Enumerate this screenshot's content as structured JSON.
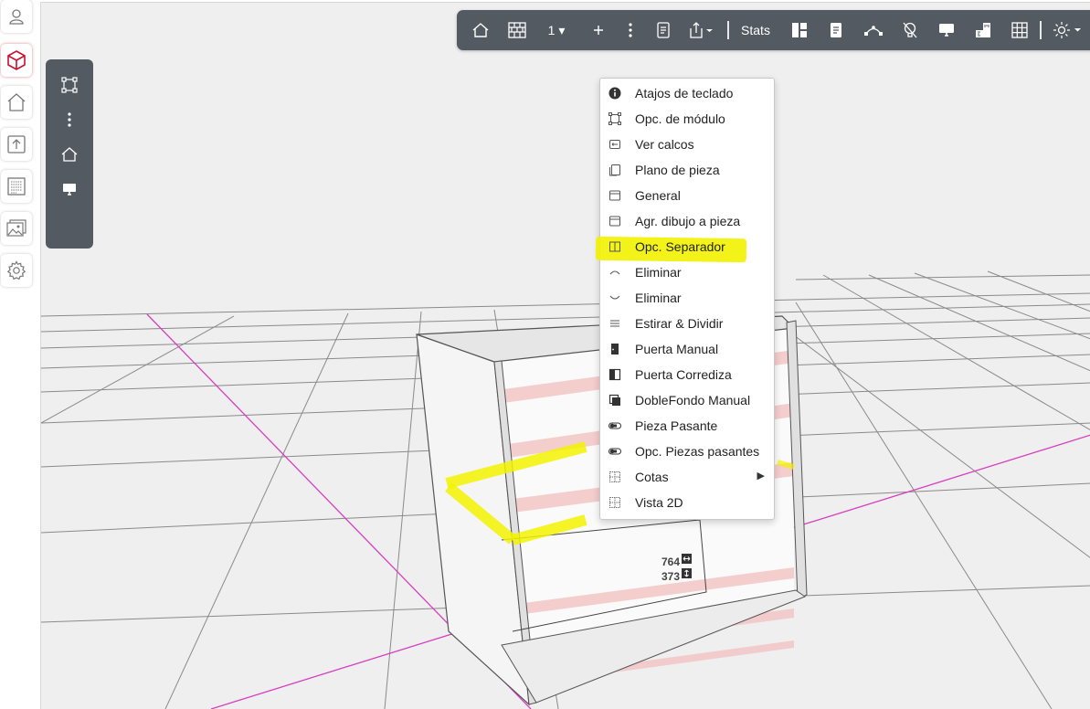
{
  "toolbar": {
    "level_label": "1 ▾",
    "stats_label": "Stats"
  },
  "context_menu": {
    "items": [
      {
        "label": "Atajos de teclado",
        "icon": "info-icon"
      },
      {
        "label": "Opc. de módulo",
        "icon": "module-frame-icon"
      },
      {
        "label": "Ver calcos",
        "icon": "decal-icon"
      },
      {
        "label": "Plano de pieza",
        "icon": "copy-sheet-icon"
      },
      {
        "label": "General",
        "icon": "window-icon"
      },
      {
        "label": "Agr. dibujo a pieza",
        "icon": "window-icon"
      },
      {
        "label": "Opc. Separador",
        "icon": "split-panel-icon"
      },
      {
        "label": "Eliminar",
        "icon": "chevron-up-icon"
      },
      {
        "label": "Eliminar",
        "icon": "chevron-down-icon"
      },
      {
        "label": "Estirar & Dividir",
        "icon": "menu-lines-icon"
      },
      {
        "label": "Puerta Manual",
        "icon": "door-icon"
      },
      {
        "label": "Puerta Corrediza",
        "icon": "half-square-icon"
      },
      {
        "label": "DobleFondo Manual",
        "icon": "double-back-icon"
      },
      {
        "label": "Pieza Pasante",
        "icon": "toggle-icon"
      },
      {
        "label": "Opc. Piezas pasantes",
        "icon": "toggle-icon"
      },
      {
        "label": "Cotas",
        "icon": "dotted-grid-icon",
        "submenu": true
      },
      {
        "label": "Vista 2D",
        "icon": "dotted-grid-icon"
      }
    ]
  },
  "dimensions": {
    "width": "764",
    "height": "373"
  },
  "colors": {
    "toolbar_bg": "#545a62",
    "highlight": "#f2f200",
    "axis": "#d63fbf",
    "stripe": "#f3c6c6"
  }
}
